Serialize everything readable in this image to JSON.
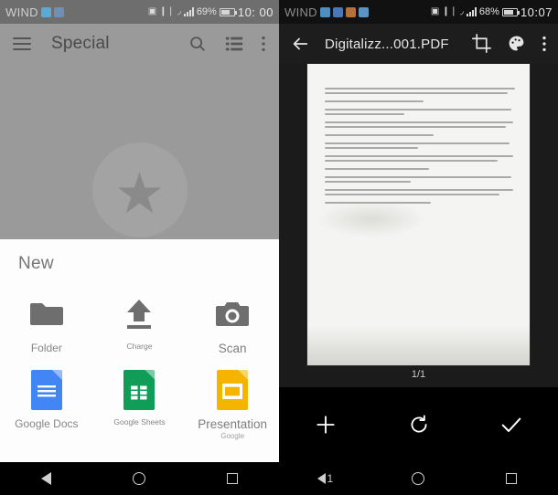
{
  "left": {
    "status": {
      "carrier": "WIND",
      "battery_percent": "69%",
      "clock": "10: 00",
      "icons": [
        "sim-icon",
        "vibrate-icon",
        "wifi-icon",
        "signal-icon",
        "battery-icon"
      ]
    },
    "appbar": {
      "menu_icon": "hamburger-menu-icon",
      "title": "Special",
      "search_icon": "search-icon",
      "list_view_icon": "list-view-icon",
      "overflow_icon": "overflow-menu-icon"
    },
    "empty_state": {
      "icon": "star-icon"
    },
    "sheet": {
      "title": "New",
      "items": [
        {
          "label": "Folder",
          "icon": "folder-icon",
          "sub": "",
          "color": "#6e6e6e"
        },
        {
          "label": "Charge",
          "icon": "upload-icon",
          "sub": "",
          "color": "#6e6e6e"
        },
        {
          "label": "Scan",
          "icon": "camera-icon",
          "sub": "",
          "color": "#6e6e6e"
        },
        {
          "label": "Google Docs",
          "icon": "google-docs-icon",
          "sub": "",
          "color": "#4285F4"
        },
        {
          "label": "Google Sheets",
          "icon": "google-sheets-icon",
          "sub": "",
          "color": "#0F9D58"
        },
        {
          "label": "Presentation",
          "icon": "google-slides-icon",
          "sub": "Google",
          "color": "#F4B400"
        }
      ]
    },
    "navbar": {
      "back": "back-icon",
      "home": "home-icon",
      "recents": "recents-icon"
    }
  },
  "right": {
    "status": {
      "carrier": "WIND",
      "battery_percent": "68%",
      "clock": "10:07",
      "icons": [
        "sim-icon",
        "vibrate-icon",
        "wifi-icon",
        "signal-icon",
        "battery-icon"
      ]
    },
    "appbar": {
      "back_icon": "back-arrow-icon",
      "title": "Digitalizz...001.PDF",
      "crop_icon": "crop-icon",
      "palette_icon": "color-palette-icon",
      "overflow_icon": "overflow-menu-icon"
    },
    "preview": {
      "page_indicator": "1/1",
      "document_paragraphs": [
        [
          100,
          96
        ],
        [
          52
        ],
        [
          98,
          42
        ],
        [
          99,
          95
        ],
        [
          57
        ],
        [
          97,
          49
        ],
        [
          99,
          91
        ],
        [
          55
        ],
        [
          98,
          45
        ],
        [
          99,
          92
        ],
        [
          56
        ]
      ]
    },
    "toolbar": [
      {
        "label": "+",
        "icon": "add-page-icon"
      },
      {
        "label": "",
        "icon": "rotate-icon"
      },
      {
        "label": "",
        "icon": "confirm-check-icon"
      }
    ],
    "navbar": {
      "back": "back-icon-one",
      "home": "home-icon",
      "recents": "recents-icon"
    }
  }
}
